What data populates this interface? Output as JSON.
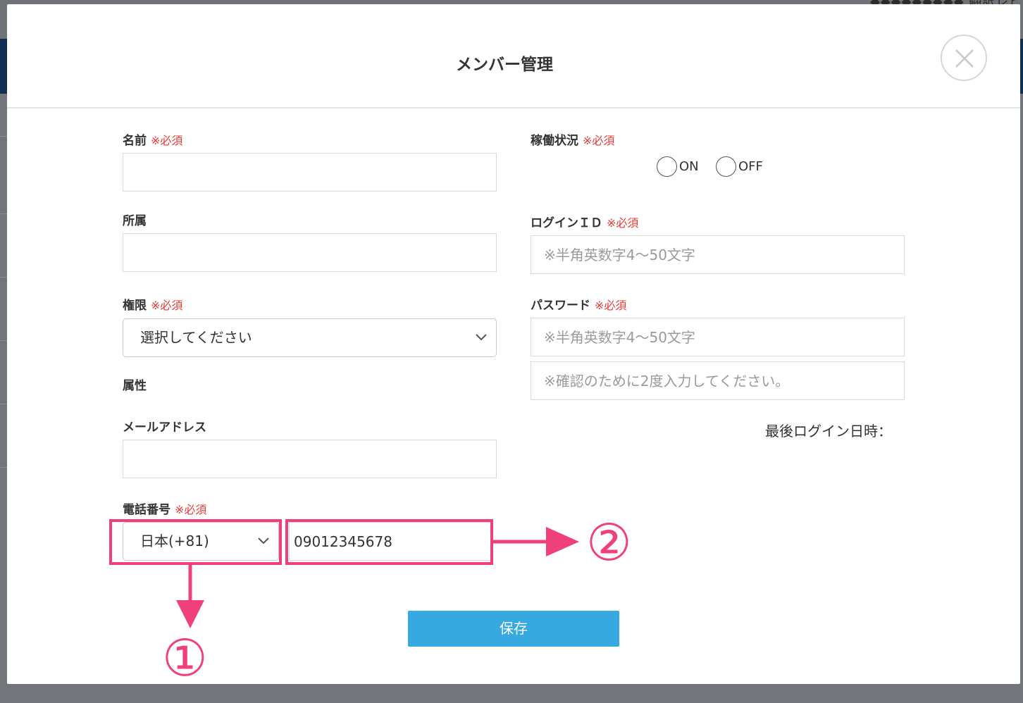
{
  "background": {
    "top_text": "◆◆◆◆◆◆◆◆◆ 翻訳レビュー登録"
  },
  "modal": {
    "title": "メンバー管理",
    "close_icon": "close-icon"
  },
  "form": {
    "required_mark": "※必須",
    "name": {
      "label": "名前",
      "value": ""
    },
    "affiliation": {
      "label": "所属",
      "value": ""
    },
    "permission": {
      "label": "権限",
      "selected": "選択してください"
    },
    "attribute": {
      "label": "属性"
    },
    "email": {
      "label": "メールアドレス",
      "value": ""
    },
    "phone": {
      "label": "電話番号",
      "country": "日本(+81)",
      "number": "09012345678"
    },
    "status": {
      "label": "稼働状況",
      "options": [
        "ON",
        "OFF"
      ]
    },
    "login_id": {
      "label": "ログインＩＤ",
      "placeholder": "※半角英数字4〜50文字"
    },
    "password": {
      "label": "パスワード",
      "placeholder": "※半角英数字4〜50文字",
      "confirm_placeholder": "※確認のために2度入力してください。"
    },
    "last_login": {
      "label": "最後ログイン日時："
    },
    "save_label": "保存"
  },
  "annotations": {
    "marker1": "①",
    "marker2": "②",
    "color": "#f0407c"
  },
  "colors": {
    "accent": "#36a9e1",
    "required": "#e53935"
  }
}
